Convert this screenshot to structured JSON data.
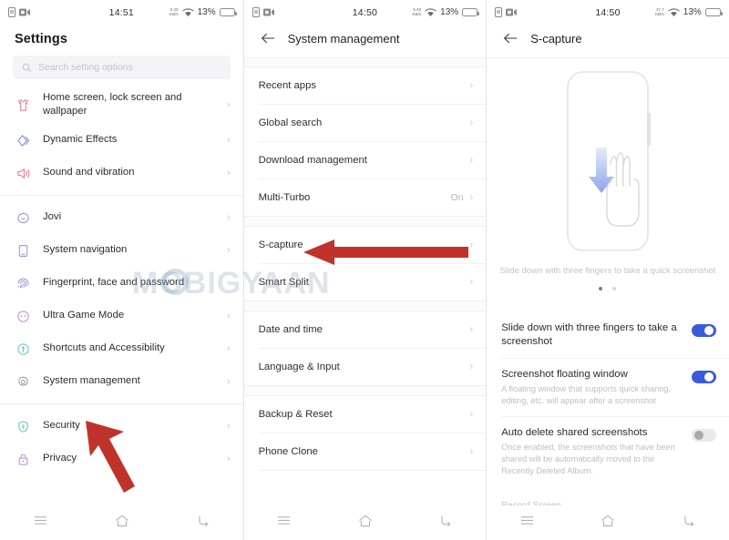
{
  "watermark": {
    "text": "MOBIGYAAN"
  },
  "colors": {
    "toggle_on": "#3b5bdb",
    "toggle_off": "#e9e9ec",
    "arrow_red": "#c0332a",
    "chevron": "#c9c9cd",
    "text_primary": "#2c2c2e",
    "text_muted": "#bfbfc4"
  },
  "panel1": {
    "status": {
      "time": "14:51",
      "battery_percent": "13%",
      "rate_up": "0.20",
      "rate_down": "KB/s",
      "icons": [
        "sim-card-icon",
        "video-recording-icon",
        "data-rate-icon",
        "wifi-icon",
        "battery-icon"
      ]
    },
    "title": "Settings",
    "search": {
      "placeholder": "Search setting options",
      "icon": "search-icon"
    },
    "groups": [
      {
        "items": [
          {
            "label": "Home screen, lock screen and wallpaper",
            "icon": "wallpaper-icon",
            "color": "#e8708a"
          },
          {
            "label": "Dynamic Effects",
            "icon": "dynamic-effects-icon",
            "color": "#7b86d6"
          },
          {
            "label": "Sound and vibration",
            "icon": "sound-icon",
            "color": "#ec6f8e"
          }
        ]
      },
      {
        "items": [
          {
            "label": "Jovi",
            "icon": "jovi-icon",
            "color": "#8f8fd4"
          },
          {
            "label": "System navigation",
            "icon": "navigation-icon",
            "color": "#8a8fd8"
          },
          {
            "label": "Fingerprint, face and password",
            "icon": "fingerprint-icon",
            "color": "#8d8fd9"
          },
          {
            "label": "Ultra Game Mode",
            "icon": "game-mode-icon",
            "color": "#c98ad6"
          },
          {
            "label": "Shortcuts and Accessibility",
            "icon": "shortcuts-icon",
            "color": "#5ec9c0"
          },
          {
            "label": "System management",
            "icon": "gear-icon",
            "color": "#9a9a9e"
          }
        ]
      },
      {
        "items": [
          {
            "label": "Security",
            "icon": "shield-icon",
            "color": "#5ec9b5"
          },
          {
            "label": "Privacy",
            "icon": "lock-icon",
            "color": "#b58ad9"
          }
        ]
      }
    ]
  },
  "panel2": {
    "status": {
      "time": "14:50",
      "battery_percent": "13%",
      "rate_up": "5.40",
      "rate_down": "KB/s"
    },
    "header": {
      "title": "System management",
      "back_icon": "back-arrow-icon"
    },
    "groups": [
      {
        "items": [
          {
            "label": "Recent apps",
            "value": ""
          },
          {
            "label": "Global search",
            "value": ""
          },
          {
            "label": "Download management",
            "value": ""
          },
          {
            "label": "Multi-Turbo",
            "value": "On"
          }
        ]
      },
      {
        "items": [
          {
            "label": "S-capture",
            "value": ""
          },
          {
            "label": "Smart Split",
            "value": ""
          }
        ]
      },
      {
        "items": [
          {
            "label": "Date and time",
            "value": ""
          },
          {
            "label": "Language & Input",
            "value": ""
          }
        ]
      },
      {
        "items": [
          {
            "label": "Backup & Reset",
            "value": ""
          },
          {
            "label": "Phone Clone",
            "value": ""
          }
        ]
      }
    ]
  },
  "panel3": {
    "status": {
      "time": "14:50",
      "battery_percent": "13%",
      "rate_up": "47.7",
      "rate_down": "KB/s"
    },
    "header": {
      "title": "S-capture",
      "back_icon": "back-arrow-icon"
    },
    "illustration": {
      "name": "three-finger-swipe-illustration",
      "caption": "Slide down with three fingers to take a quick screenshot"
    },
    "pager": {
      "count": 2,
      "active": 0
    },
    "toggles": [
      {
        "title": "Slide down with three fingers to take a screenshot",
        "subtitle": "",
        "state": "on"
      },
      {
        "title": "Screenshot floating window",
        "subtitle": "A floating window that supports quick sharing, editing, etc. will appear after a screenshot",
        "state": "on"
      },
      {
        "title": "Auto delete shared screenshots",
        "subtitle": "Once enabled, the screenshots that have been shared will be automatically moved to the Recently Deleted Album.",
        "state": "off"
      }
    ],
    "record_section_title": "Record Screen"
  },
  "bottom_nav": {
    "items": [
      {
        "icon": "recents-menu-icon",
        "label": ""
      },
      {
        "icon": "home-icon",
        "label": ""
      },
      {
        "icon": "back-icon",
        "label": ""
      }
    ]
  }
}
